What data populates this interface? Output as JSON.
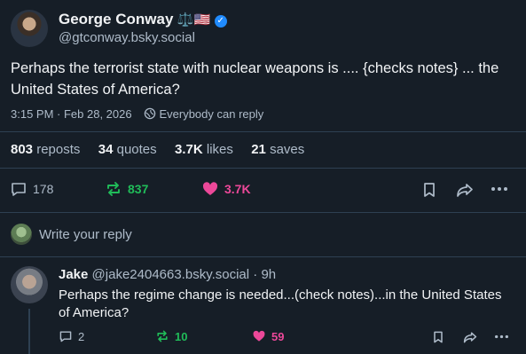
{
  "post": {
    "author_name": "George Conway",
    "author_emoji": "⚖️🇺🇸",
    "handle": "@gtconway.bsky.social",
    "text": "Perhaps the terrorist state with nuclear weapons is .... {checks notes} ... the United States of America?",
    "timestamp": "3:15 PM · Feb 28, 2026",
    "reply_setting": "Everybody can reply",
    "stats": {
      "reposts_count": "803",
      "reposts_label": "reposts",
      "quotes_count": "34",
      "quotes_label": "quotes",
      "likes_count": "3.7K",
      "likes_label": "likes",
      "saves_count": "21",
      "saves_label": "saves"
    },
    "actions": {
      "replies": "178",
      "reposts": "837",
      "likes": "3.7K"
    }
  },
  "composer": {
    "placeholder": "Write your reply"
  },
  "reply": {
    "author_name": "Jake",
    "handle": "@jake2404663.bsky.social",
    "age": "· 9h",
    "text": "Perhaps the regime change is needed...(check notes)...in the United States of America?",
    "actions": {
      "replies": "2",
      "reposts": "10",
      "likes": "59"
    }
  },
  "colors": {
    "background": "#161e27",
    "repost": "#20bc59",
    "like": "#ec4899",
    "accent": "#208bfe",
    "muted": "#aebbc9"
  }
}
